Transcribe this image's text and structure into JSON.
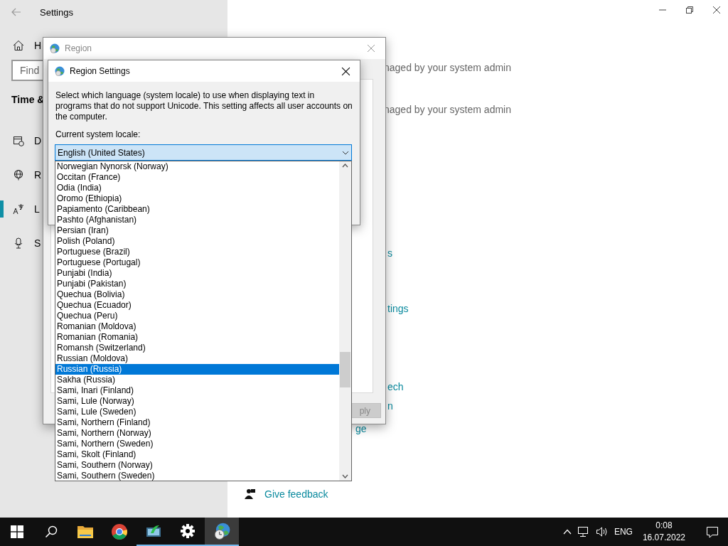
{
  "settings": {
    "title": "Settings",
    "home": "H",
    "search": {
      "placeholder": "Find"
    },
    "section": "Time &",
    "nav": [
      {
        "label": "D",
        "kind": "calendar",
        "selected": false
      },
      {
        "label": "R",
        "kind": "globe",
        "selected": false
      },
      {
        "label": "L",
        "kind": "language",
        "selected": true
      },
      {
        "label": "S",
        "kind": "microphone",
        "selected": false
      }
    ],
    "right_texts": [
      {
        "text": "naged by your system admin",
        "kind": "note"
      },
      {
        "text": "naged by your system admin",
        "kind": "note"
      },
      {
        "text": "s",
        "kind": "link"
      },
      {
        "text": "tings",
        "kind": "link"
      },
      {
        "text": "ech",
        "kind": "link"
      },
      {
        "text": "n",
        "kind": "link"
      },
      {
        "text": "ge",
        "kind": "link"
      }
    ],
    "feedback": "Give feedback"
  },
  "region_dialog": {
    "title": "Region",
    "apply": {
      "label": "ply",
      "disabled": true
    }
  },
  "region_settings": {
    "title": "Region Settings",
    "description": "Select which language (system locale) to use when displaying text in programs that do not support Unicode. This setting affects all user accounts on the computer.",
    "label": "Current system locale:",
    "value": "English (United States)",
    "options": [
      {
        "label": "Norwegian Nynorsk (Norway)",
        "selected": false
      },
      {
        "label": "Occitan (France)",
        "selected": false
      },
      {
        "label": "Odia (India)",
        "selected": false
      },
      {
        "label": "Oromo (Ethiopia)",
        "selected": false
      },
      {
        "label": "Papiamento (Caribbean)",
        "selected": false
      },
      {
        "label": "Pashto (Afghanistan)",
        "selected": false
      },
      {
        "label": "Persian (Iran)",
        "selected": false
      },
      {
        "label": "Polish (Poland)",
        "selected": false
      },
      {
        "label": "Portuguese (Brazil)",
        "selected": false
      },
      {
        "label": "Portuguese (Portugal)",
        "selected": false
      },
      {
        "label": "Punjabi (India)",
        "selected": false
      },
      {
        "label": "Punjabi (Pakistan)",
        "selected": false
      },
      {
        "label": "Quechua (Bolivia)",
        "selected": false
      },
      {
        "label": "Quechua (Ecuador)",
        "selected": false
      },
      {
        "label": "Quechua (Peru)",
        "selected": false
      },
      {
        "label": "Romanian (Moldova)",
        "selected": false
      },
      {
        "label": "Romanian (Romania)",
        "selected": false
      },
      {
        "label": "Romansh (Switzerland)",
        "selected": false
      },
      {
        "label": "Russian (Moldova)",
        "selected": false
      },
      {
        "label": "Russian (Russia)",
        "selected": true
      },
      {
        "label": "Sakha (Russia)",
        "selected": false
      },
      {
        "label": "Sami, Inari (Finland)",
        "selected": false
      },
      {
        "label": "Sami, Lule (Norway)",
        "selected": false
      },
      {
        "label": "Sami, Lule (Sweden)",
        "selected": false
      },
      {
        "label": "Sami, Northern (Finland)",
        "selected": false
      },
      {
        "label": "Sami, Northern (Norway)",
        "selected": false
      },
      {
        "label": "Sami, Northern (Sweden)",
        "selected": false
      },
      {
        "label": "Sami, Skolt (Finland)",
        "selected": false
      },
      {
        "label": "Sami, Southern (Norway)",
        "selected": false
      },
      {
        "label": "Sami, Southern (Sweden)",
        "selected": false
      }
    ]
  },
  "taskbar": {
    "apps": [
      {
        "kind": "folder",
        "running": false,
        "selected": false
      },
      {
        "kind": "chrome",
        "running": false,
        "selected": false
      },
      {
        "kind": "monitor",
        "running": true,
        "selected": false
      },
      {
        "kind": "gear",
        "running": true,
        "selected": false
      },
      {
        "kind": "globe",
        "running": true,
        "selected": true
      }
    ],
    "language": "ENG",
    "time": "0:08",
    "date": "16.07.2022"
  }
}
